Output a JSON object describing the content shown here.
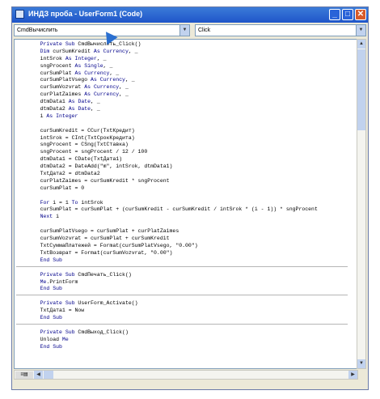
{
  "window": {
    "title": "ИНДЗ проба - UserForm1 (Code)",
    "minimize": "_",
    "maximize": "□",
    "close": "✕"
  },
  "toolbar": {
    "object_combo": "CmdВычислить",
    "procedure_combo": "Click"
  },
  "code": {
    "lines": [
      "    Private Sub CmdВычислить_Click()",
      "    Dim curSumKredit As Currency, _",
      "    intSrok As Integer, _",
      "    sngProcent As Single, _",
      "    curSumPlat As Currency, _",
      "    curSumPlatVsego As Currency, _",
      "    curSumVozvrat As Currency, _",
      "    curPlatZaimes As Currency, _",
      "    dtmData1 As Date, _",
      "    dtmData2 As Date, _",
      "    i As Integer",
      "",
      "    curSumKredit = CCur(TxtКредит)",
      "    intSrok = CInt(TxtСрокКредита)",
      "    sngProcent = CSng(TxtСтавка)",
      "    sngProcent = sngProcent / 12 / 100",
      "    dtmData1 = CDate(TxtДата1)",
      "    dtmData2 = DateAdd(\"m\", intSrok, dtmData1)",
      "    TxtДата2 = dtmData2",
      "    curPlatZaimes = curSumKredit * sngProcent",
      "    curSumPlat = 0",
      "",
      "    For i = 1 To intSrok",
      "    curSumPlat = curSumPlat + (curSumKredit - curSumKredit / intSrok * (i - 1)) * sngProcent",
      "    Next i",
      "",
      "    curSumPlatVsego = curSumPlat + curPlatZaimes",
      "    curSumVozvrat = curSumPlat + curSumKredit",
      "    TxtСуммаПлатежей = Format(curSumPlatVsego, \"0.00\")",
      "    TxtВозврат = Format(curSumVozvrat, \"0.00\")",
      "    End Sub"
    ],
    "proc2": [
      "    Private Sub CmdПечать_Click()",
      "    Me.PrintForm",
      "    End Sub"
    ],
    "proc3": [
      "    Private Sub UserForm_Activate()",
      "    TxtДата1 = Now",
      "    End Sub"
    ],
    "proc4": [
      "    Private Sub CmdВыход_Click()",
      "    Unload Me",
      "    End Sub"
    ]
  },
  "icons": {
    "app": "vba-project-icon",
    "dropdown": "chevron-down-icon",
    "cursor": "mouse-pointer-icon"
  },
  "colors": {
    "titlebar": "#1f55c9",
    "keyword": "#00008b"
  }
}
